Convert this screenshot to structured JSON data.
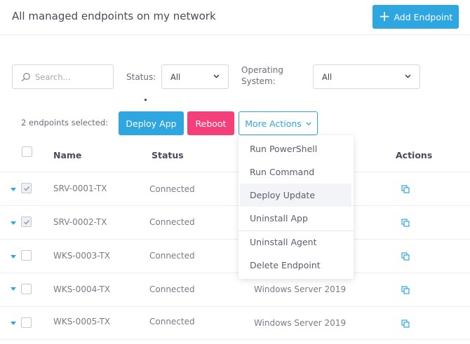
{
  "header": {
    "title": "All managed endpoints on my network",
    "add_button_label": "Add Endpoint"
  },
  "filters": {
    "search_placeholder": "Search...",
    "status_label": "Status:",
    "status_value": "All",
    "os_label_line1": "Operating",
    "os_label_line2": "System:",
    "os_value": "All"
  },
  "bulk": {
    "selected_text": "2 endpoints selected:",
    "deploy_label": "Deploy App",
    "reboot_label": "Reboot",
    "more_label": "More Actions"
  },
  "table": {
    "columns": [
      "Name",
      "Status",
      "Actions"
    ],
    "rows": [
      {
        "name": "SRV-0001-TX",
        "status": "Connected",
        "os": "",
        "checked": true
      },
      {
        "name": "SRV-0002-TX",
        "status": "Connected",
        "os": "",
        "checked": true
      },
      {
        "name": "WKS-0003-TX",
        "status": "Connected",
        "os": "",
        "checked": false
      },
      {
        "name": "WKS-0004-TX",
        "status": "Connected",
        "os": "Windows Server 2019",
        "checked": false
      },
      {
        "name": "WKS-0005-TX",
        "status": "Connected",
        "os": "Windows Server 2019",
        "checked": false
      }
    ]
  },
  "dropdown": {
    "items": [
      "Run PowerShell",
      "Run Command",
      "Deploy Update",
      "Uninstall App",
      "Uninstall Agent",
      "Delete Endpoint"
    ],
    "highlighted": "Deploy Update"
  },
  "colors": {
    "accent": "#2ea6e0",
    "danger": "#f53f7b"
  },
  "icons": [
    "plus-icon",
    "search-icon",
    "chevron-down-icon",
    "check-icon",
    "caret-down-icon",
    "copy-icon"
  ]
}
